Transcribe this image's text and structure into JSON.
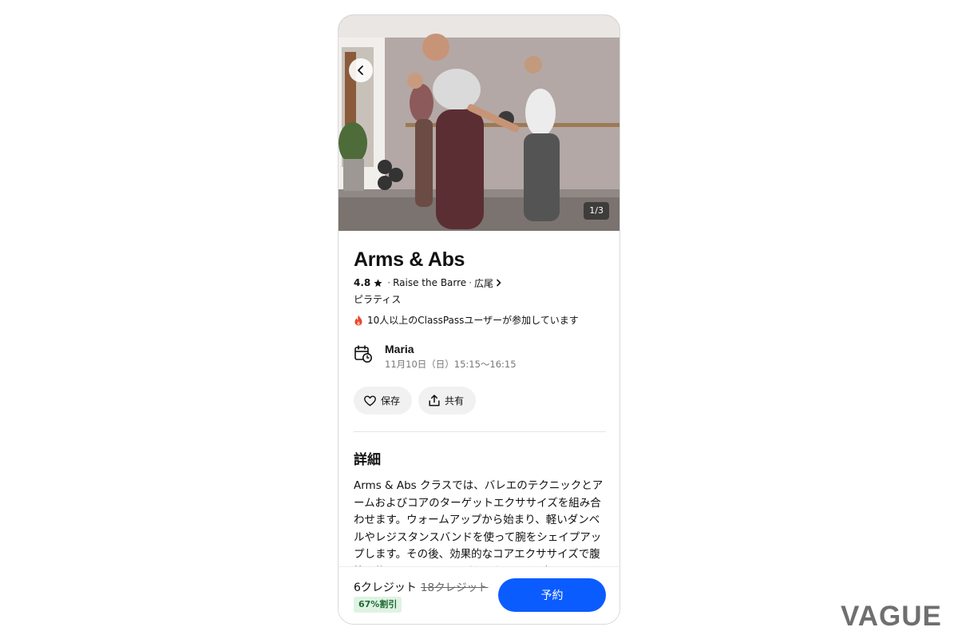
{
  "hero": {
    "photo_counter": "1/3"
  },
  "class": {
    "title": "Arms & Abs",
    "rating": "4.8",
    "studio": "Raise the Barre",
    "area": "広尾",
    "category": "ピラティス",
    "popularity_note": "10人以上のClassPassユーザーが参加しています"
  },
  "schedule": {
    "instructor": "Maria",
    "datetime": "11月10日（日）15:15〜16:15"
  },
  "actions": {
    "save_label": "保存",
    "share_label": "共有"
  },
  "details": {
    "heading": "詳細",
    "description": "Arms & Abs クラスでは、バレエのテクニックとアームおよびコアのターゲットエクササイズを組み合わせます。ウォームアップから始まり、軽いダンベルやレジスタンスバンドを使って腕をシェイプアップします。その後、効果的なコアエクササイズで腹筋を鍛え、バレエの原則を取り入れながら"
  },
  "footer": {
    "price": "6クレジット",
    "original_price": "18クレジット",
    "discount": "67%割引",
    "book_label": "予約"
  },
  "watermark": "VAGUE",
  "colors": {
    "book_button": "#0b5cff",
    "discount_bg": "#dff3e3",
    "discount_text": "#1f6b34",
    "flame": "#e8472d"
  },
  "icons": [
    "back-arrow-icon",
    "star-icon",
    "chevron-right-icon",
    "flame-icon",
    "calendar-clock-icon",
    "heart-icon",
    "share-icon"
  ]
}
